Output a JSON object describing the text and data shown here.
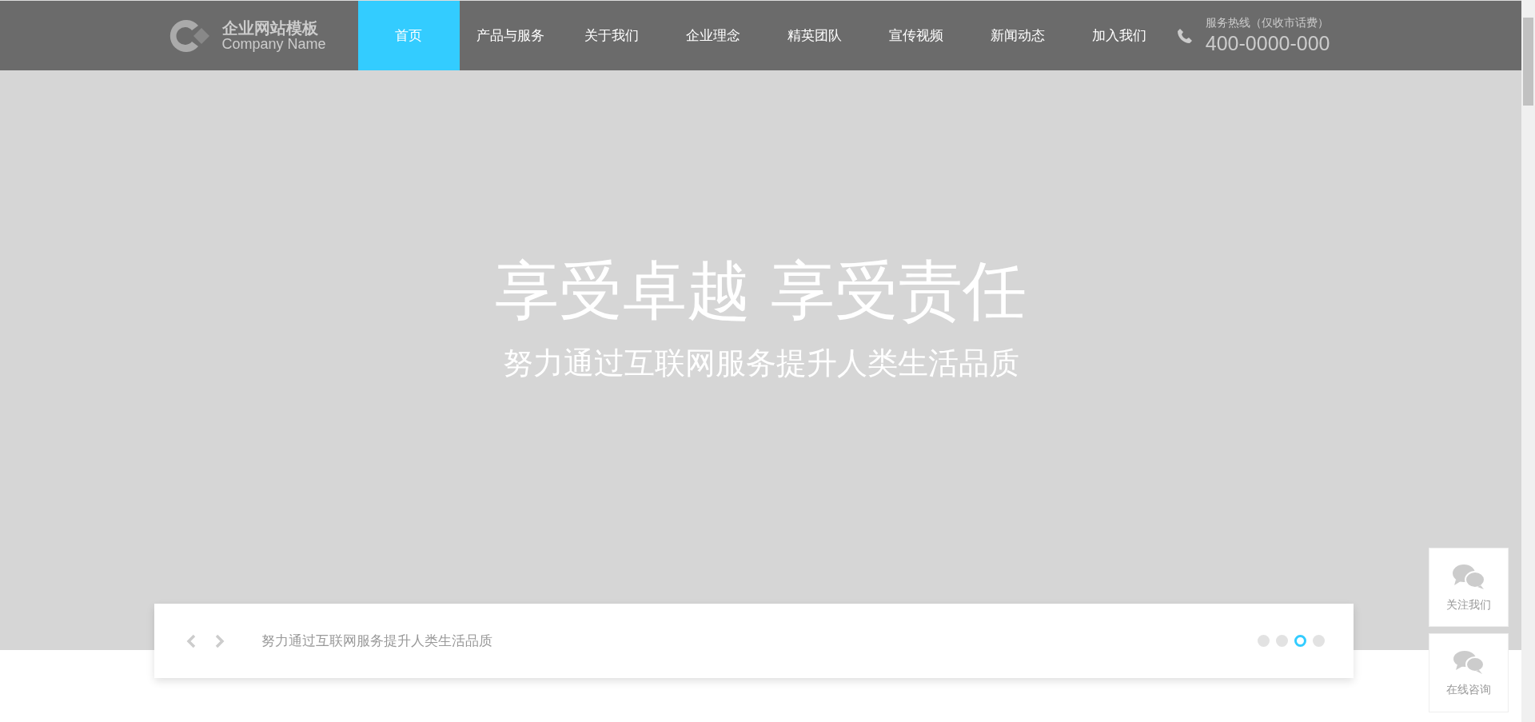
{
  "logo": {
    "title": "企业网站模板",
    "subtitle": "Company Name"
  },
  "nav": [
    {
      "label": "首页",
      "selected": true
    },
    {
      "label": "产品与服务",
      "selected": false
    },
    {
      "label": "关于我们",
      "selected": false
    },
    {
      "label": "企业理念",
      "selected": false
    },
    {
      "label": "精英团队",
      "selected": false
    },
    {
      "label": "宣传视频",
      "selected": false
    },
    {
      "label": "新闻动态",
      "selected": false
    },
    {
      "label": "加入我们",
      "selected": false
    }
  ],
  "hotline": {
    "label": "服务热线（仅收市话费）",
    "number": "400-0000-000"
  },
  "hero": {
    "title": "享受卓越 享受责任",
    "subtitle": "努力通过互联网服务提升人类生活品质"
  },
  "slider": {
    "caption": "努力通过互联网服务提升人类生活品质",
    "dots": [
      {
        "selected": false
      },
      {
        "selected": false
      },
      {
        "selected": true
      },
      {
        "selected": false
      }
    ]
  },
  "side_buttons": [
    {
      "kind": "wechat",
      "label": "关注我们"
    },
    {
      "kind": "chat",
      "label": "在线咨询"
    }
  ]
}
